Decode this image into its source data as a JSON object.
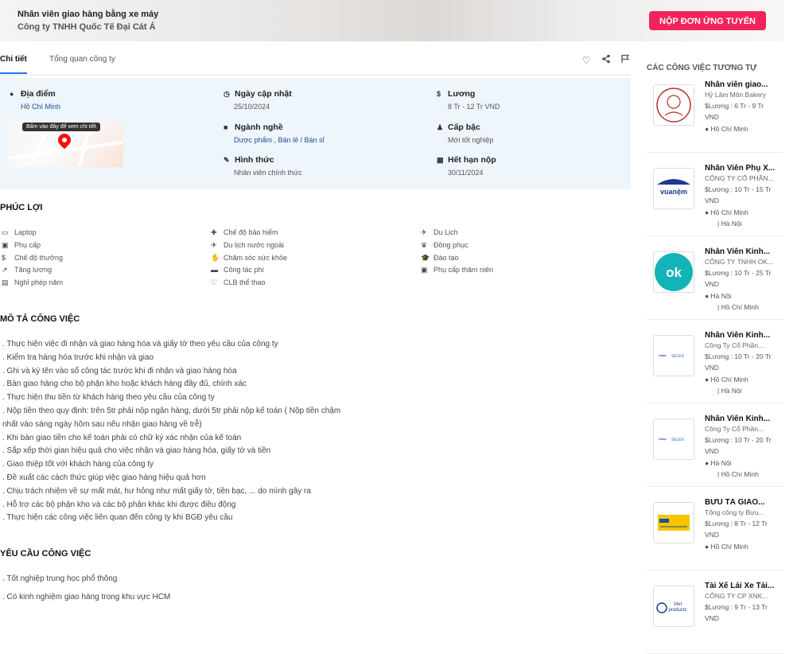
{
  "header": {
    "job_title": "Nhân viên giao hàng bằng xe máy",
    "company": "Công ty TNHH Quốc Tế Đại Cát Á",
    "apply_label": "NỘP ĐƠN ỨNG TUYỂN",
    "accent_color": "#f0245a"
  },
  "tabs": [
    {
      "label": "Chi tiết",
      "active": true
    },
    {
      "label": "Tổng quan công ty",
      "active": false
    }
  ],
  "tab_icons": [
    "heart-icon",
    "share-icon",
    "flag-icon"
  ],
  "info": {
    "location": {
      "label": "Địa điểm",
      "value": "Hồ Chí Minh"
    },
    "updated": {
      "label": "Ngày cập nhật",
      "value": "25/10/2024"
    },
    "salary": {
      "label": "Lương",
      "value": "8 Tr - 12 Tr VND"
    },
    "industry": {
      "label": "Ngành nghề",
      "value": "Dược phẩm , Bán lẻ / Bán sỉ"
    },
    "level": {
      "label": "Cấp bậc",
      "value": "Mới tốt nghiệp"
    },
    "type": {
      "label": "Hình thức",
      "value": "Nhân viên chính thức"
    },
    "deadline": {
      "label": "Hết hạn nộp",
      "value": "30/11/2024"
    },
    "map_tip": "Bấm vào đây để xem chi tiết"
  },
  "benefits": {
    "title": "PHÚC LỢI",
    "items": [
      {
        "label": "Laptop",
        "icon": "laptop-icon",
        "glyph": "▭"
      },
      {
        "label": "Phụ cấp",
        "icon": "allowance-icon",
        "glyph": "▣"
      },
      {
        "label": "Chế độ thưởng",
        "icon": "dollar-icon",
        "glyph": "$"
      },
      {
        "label": "Tăng lương",
        "icon": "chart-up-icon",
        "glyph": "↗"
      },
      {
        "label": "Nghỉ phép năm",
        "icon": "calendar-icon",
        "glyph": "▤"
      },
      {
        "label": "Chế độ bảo hiểm",
        "icon": "medkit-icon",
        "glyph": "✚"
      },
      {
        "label": "Du lịch nước ngoài",
        "icon": "plane-icon",
        "glyph": "✈"
      },
      {
        "label": "Chăm sóc sức khỏe",
        "icon": "health-icon",
        "glyph": "✋"
      },
      {
        "label": "Công tác phí",
        "icon": "card-icon",
        "glyph": "▬"
      },
      {
        "label": "CLB thể thao",
        "icon": "heart-pulse-icon",
        "glyph": "♡"
      },
      {
        "label": "Du Lịch",
        "icon": "plane-icon",
        "glyph": "✈"
      },
      {
        "label": "Đồng phục",
        "icon": "shirt-icon",
        "glyph": "♛"
      },
      {
        "label": "Đào tạo",
        "icon": "graduation-icon",
        "glyph": "🎓"
      },
      {
        "label": "Phụ cấp thâm niên",
        "icon": "money-icon",
        "glyph": "▣"
      }
    ]
  },
  "description": {
    "title": "MÔ TẢ CÔNG VIỆC",
    "lines": [
      ". Thực hiện việc đi nhận và giao hàng hóa và giấy tờ theo yêu cầu của công ty",
      ". Kiểm tra hàng hóa trước khi nhận và giao",
      ". Ghi và ký tên vào sổ công tác trước khi đi nhận và giao hàng hóa",
      ". Bàn giao hàng cho bộ phận kho hoặc khách hàng đầy đủ, chính xác",
      ". Thực hiện thu tiền từ khách hàng theo yêu cầu của công ty",
      ". Nộp tiền theo quy định: trên 5tr phải nộp ngân hàng, dưới 5tr phải nộp kế toán ( Nộp tiền chậm",
      "nhất vào sáng ngày hôm sau nếu nhận giao hàng về trễ)",
      ". Khi bàn giao tiền cho kế toán phải có chữ ký xác nhận của kế toán",
      ". Sắp xếp thời gian hiệu quả cho việc nhận và giao hàng hóa, giấy tờ và tiền",
      ". Giao thiệp tốt với khách hàng của công ty",
      ". Đề xuất các cách thức giúp việc giao hàng hiệu quả hơn",
      ". Chịu trách nhiệm về sự mất mát, hư hỏng như mất giấy tờ, tiền bạc, ... do mình gây ra",
      ". Hỗ trợ các bộ phận kho và các bộ phận khác khi được điều động",
      ". Thực hiện các công việc liên quan đến công ty khi BGĐ yêu cầu"
    ]
  },
  "requirements": {
    "title": "YÊU CẦU CÔNG VIỆC",
    "lines": [
      ". Tốt nghiệp trung học phổ thông",
      ". Có kinh nghiệm giao hàng trong khu vực HCM"
    ]
  },
  "sidebar": {
    "title": "CÁC CÔNG VIỆC TƯƠNG TỰ",
    "cards": [
      {
        "title": "Nhân viên giao...",
        "company": "Hỷ Lâm Môn Bakery",
        "salary": "$Lương : 6 Tr - 9 Tr VND",
        "locations": [
          "Hồ Chí Minh"
        ],
        "logo": "hy-lam-mon-logo"
      },
      {
        "title": "Nhân Viên Phụ X...",
        "company": "CÔNG TY CỔ PHẦN...",
        "salary": "$Lương : 10 Tr - 15 Tr VND",
        "locations": [
          "Hồ Chí Minh",
          "| Hà Nội"
        ],
        "logo": "vuanem-logo"
      },
      {
        "title": "Nhân Viên Kinh...",
        "company": "CÔNG TY TNHH OK...",
        "salary": "$Lương : 10 Tr - 25 Tr VND",
        "locations": [
          "Hà Nội",
          "| Hồ Chí Minh"
        ],
        "logo": "ok-logo"
      },
      {
        "title": "Nhân Viên Kinh...",
        "company": "Công Ty Cổ Phần...",
        "salary": "$Lương : 10 Tr - 20 Tr VND",
        "locations": [
          "Hồ Chí Minh",
          "| Hà Nội"
        ],
        "logo": "selex-logo"
      },
      {
        "title": "Nhân Viên Kinh...",
        "company": "Công Ty Cổ Phần...",
        "salary": "$Lương : 10 Tr - 20 Tr VND",
        "locations": [
          "Hà Nội",
          "| Hồ Chí Minh"
        ],
        "logo": "selex-logo"
      },
      {
        "title": "BƯU TÁ GIAO...",
        "company": "Tổng công ty Bưu...",
        "salary": "$Lương : 8 Tr - 12 Tr VND",
        "locations": [
          "Hồ Chí Minh"
        ],
        "logo": "vnpost-logo"
      },
      {
        "title": "Tài Xế Lái Xe Tải...",
        "company": "CÔNG TY CP XNK...",
        "salary": "$Lương : 9 Tr - 13 Tr VND",
        "locations": [],
        "logo": "viet-products-logo"
      }
    ]
  }
}
